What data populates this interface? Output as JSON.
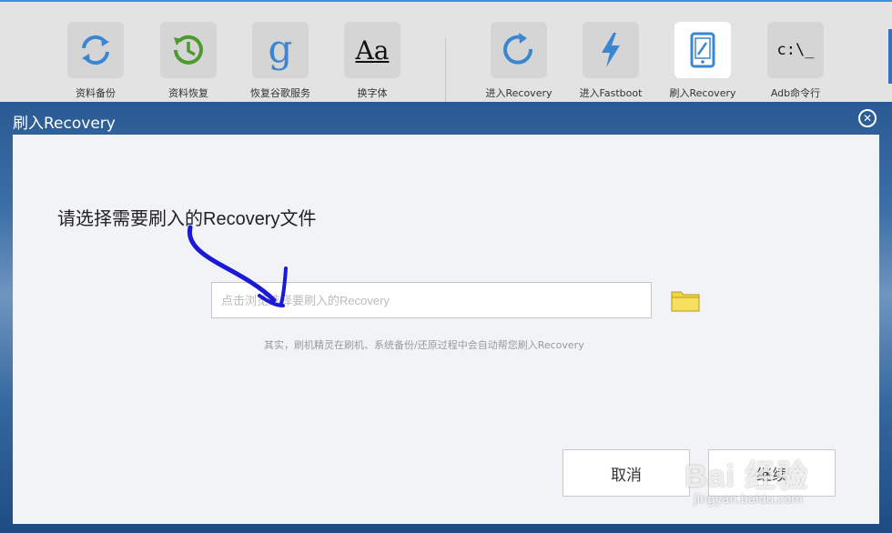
{
  "toolbar": {
    "items": [
      {
        "label": "资料备份",
        "icon": "sync-icon"
      },
      {
        "label": "资料恢复",
        "icon": "history-icon"
      },
      {
        "label": "恢复谷歌服务",
        "icon": "google-g-icon"
      },
      {
        "label": "换字体",
        "icon": "font-icon",
        "glyph": "Aa"
      },
      {
        "label": "进入Recovery",
        "icon": "refresh-icon"
      },
      {
        "label": "进入Fastboot",
        "icon": "lightning-icon"
      },
      {
        "label": "刷入Recovery",
        "icon": "phone-edit-icon",
        "active": true
      },
      {
        "label": "Adb命令行",
        "icon": "terminal-icon",
        "glyph": "c:\\_"
      }
    ]
  },
  "dialog": {
    "title": "刷入Recovery",
    "prompt": "请选择需要刷入的Recovery文件",
    "file_input": {
      "placeholder": "点击浏览选择要刷入的Recovery",
      "value": ""
    },
    "hint": "其实，刷机精灵在刷机、系统备份/还原过程中会自动帮您刷入Recovery",
    "cancel_label": "取消",
    "continue_label": "继续"
  },
  "watermark": {
    "logo": "Bai 经验",
    "url": "jingyan.baidu.com"
  },
  "colors": {
    "accent_blue": "#3a8ee6",
    "annotation_arrow": "#1a1ad6",
    "folder": "#f2d541"
  }
}
